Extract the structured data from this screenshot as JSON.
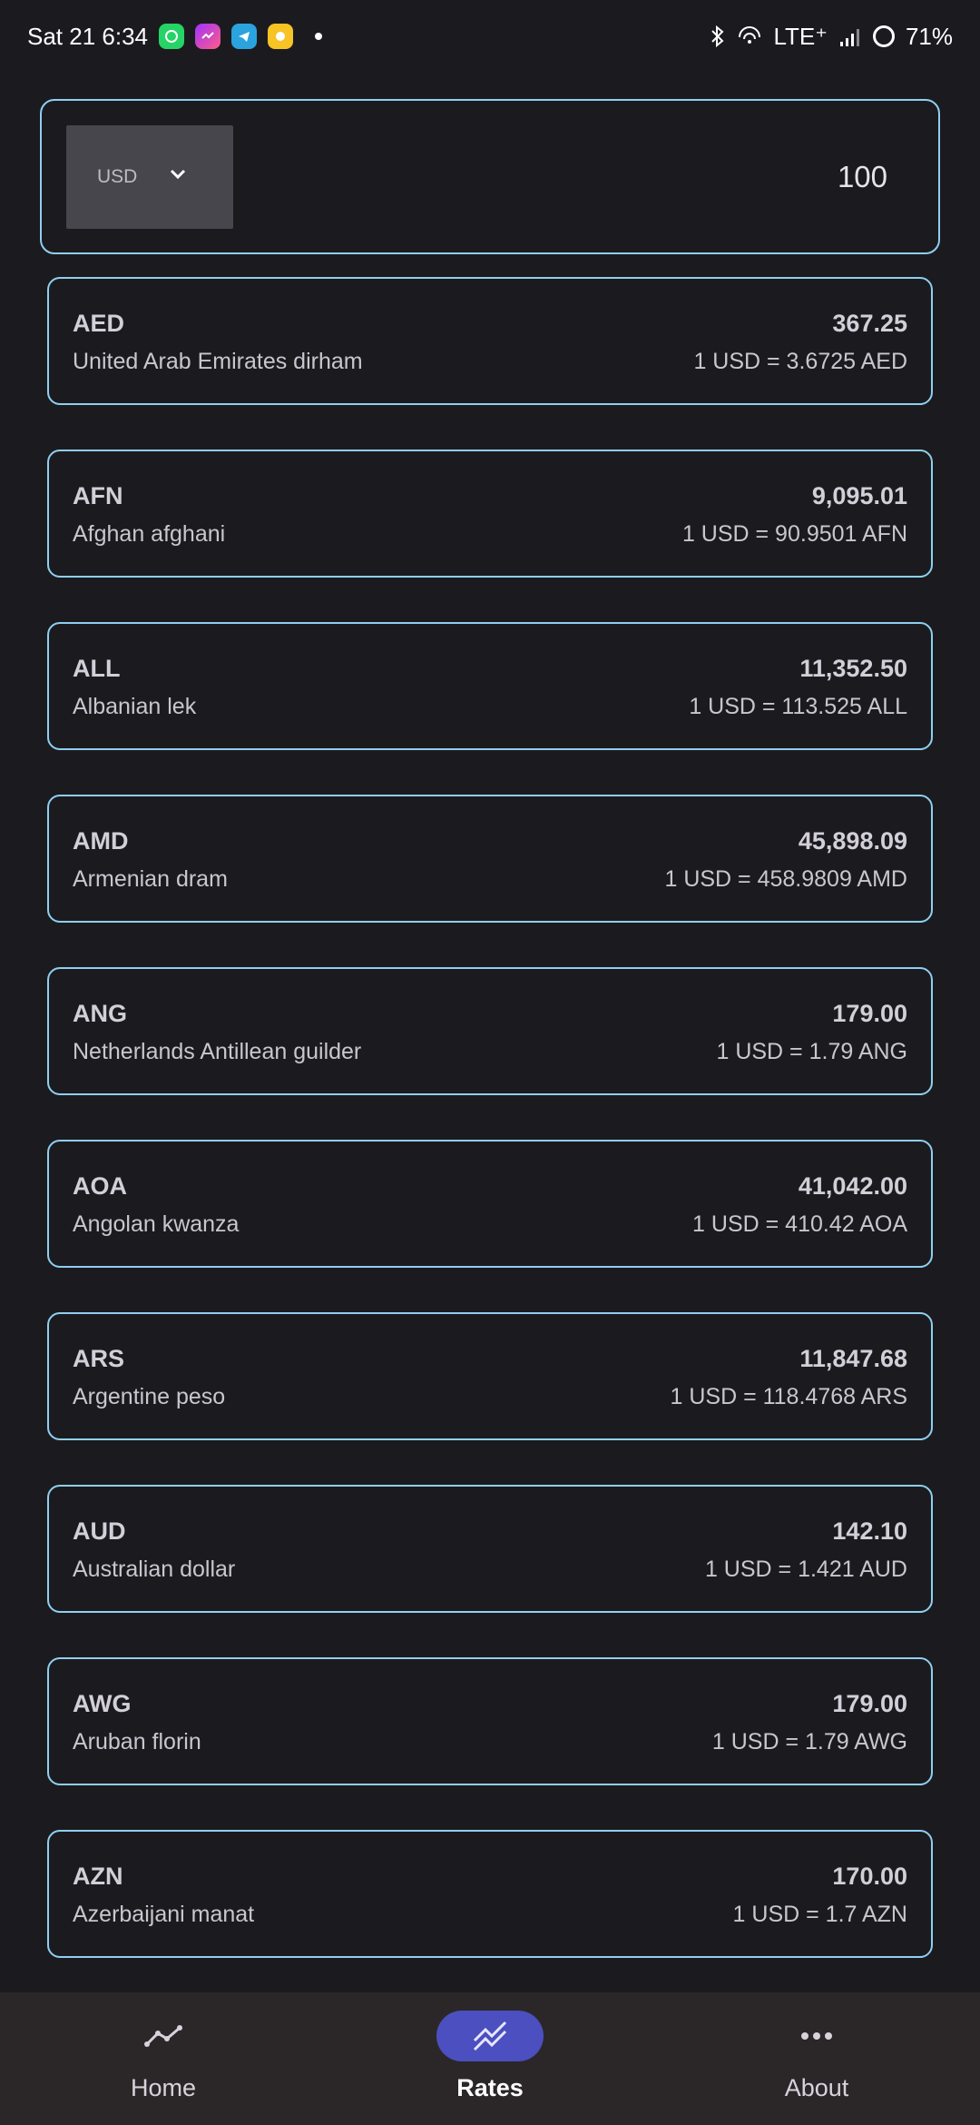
{
  "status_bar": {
    "time": "Sat 21 6:34",
    "network": "LTE⁺",
    "battery": "71%",
    "app_icons": [
      "whatsapp-icon",
      "messenger-icon",
      "telegram-icon",
      "yellow-app-icon"
    ]
  },
  "converter": {
    "base_currency": "USD",
    "amount": "100"
  },
  "rates": [
    {
      "code": "AED",
      "name": "United Arab Emirates dirham",
      "converted": "367.25",
      "rate": "1 USD = 3.6725 AED"
    },
    {
      "code": "AFN",
      "name": "Afghan afghani",
      "converted": "9,095.01",
      "rate": "1 USD = 90.9501 AFN"
    },
    {
      "code": "ALL",
      "name": "Albanian lek",
      "converted": "11,352.50",
      "rate": "1 USD = 113.525 ALL"
    },
    {
      "code": "AMD",
      "name": "Armenian dram",
      "converted": "45,898.09",
      "rate": "1 USD = 458.9809 AMD"
    },
    {
      "code": "ANG",
      "name": "Netherlands Antillean guilder",
      "converted": "179.00",
      "rate": "1 USD = 1.79 ANG"
    },
    {
      "code": "AOA",
      "name": "Angolan kwanza",
      "converted": "41,042.00",
      "rate": "1 USD = 410.42 AOA"
    },
    {
      "code": "ARS",
      "name": "Argentine peso",
      "converted": "11,847.68",
      "rate": "1 USD = 118.4768 ARS"
    },
    {
      "code": "AUD",
      "name": "Australian dollar",
      "converted": "142.10",
      "rate": "1 USD = 1.421 AUD"
    },
    {
      "code": "AWG",
      "name": "Aruban florin",
      "converted": "179.00",
      "rate": "1 USD = 1.79 AWG"
    },
    {
      "code": "AZN",
      "name": "Azerbaijani manat",
      "converted": "170.00",
      "rate": "1 USD = 1.7 AZN"
    }
  ],
  "nav": {
    "home": "Home",
    "rates": "Rates",
    "about": "About",
    "active": "rates"
  },
  "colors": {
    "background": "#1b1b1f",
    "card_border": "#8fcff0",
    "nav_background": "#2b2728",
    "nav_active_pill": "#4b4fbf"
  }
}
